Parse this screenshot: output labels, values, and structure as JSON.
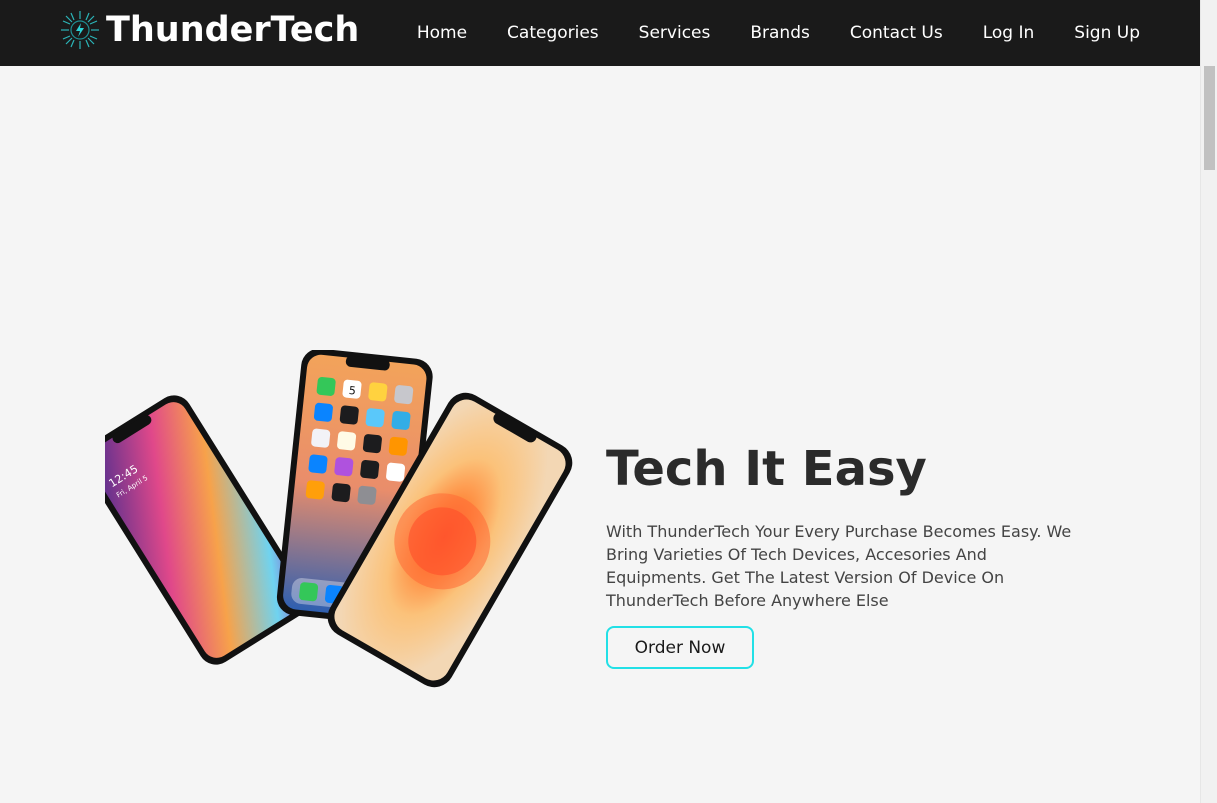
{
  "brand": {
    "name": "ThunderTech",
    "logo_icon": "lightning-bolt-sun-icon"
  },
  "nav": {
    "items": [
      {
        "label": "Home"
      },
      {
        "label": "Categories"
      },
      {
        "label": "Services"
      },
      {
        "label": "Brands"
      },
      {
        "label": "Contact Us"
      },
      {
        "label": "Log In"
      },
      {
        "label": "Sign Up"
      }
    ]
  },
  "hero": {
    "title": "Tech It Easy",
    "description": "With ThunderTech Your Every Purchase Becomes Easy. We Bring Varieties Of Tech Devices, Accesories And Equipments. Get The Latest Version Of Device On ThunderTech Before Anywhere Else",
    "cta_label": "Order Now"
  },
  "phones": {
    "left": {
      "time": "12:45",
      "date": "Fri, April 5"
    },
    "middle": {
      "calendar_day": "5"
    }
  },
  "colors": {
    "navbar_bg": "#1a1a1a",
    "page_bg": "#f5f5f5",
    "accent": "#22e0e6",
    "title_text": "#2b2b2b"
  }
}
